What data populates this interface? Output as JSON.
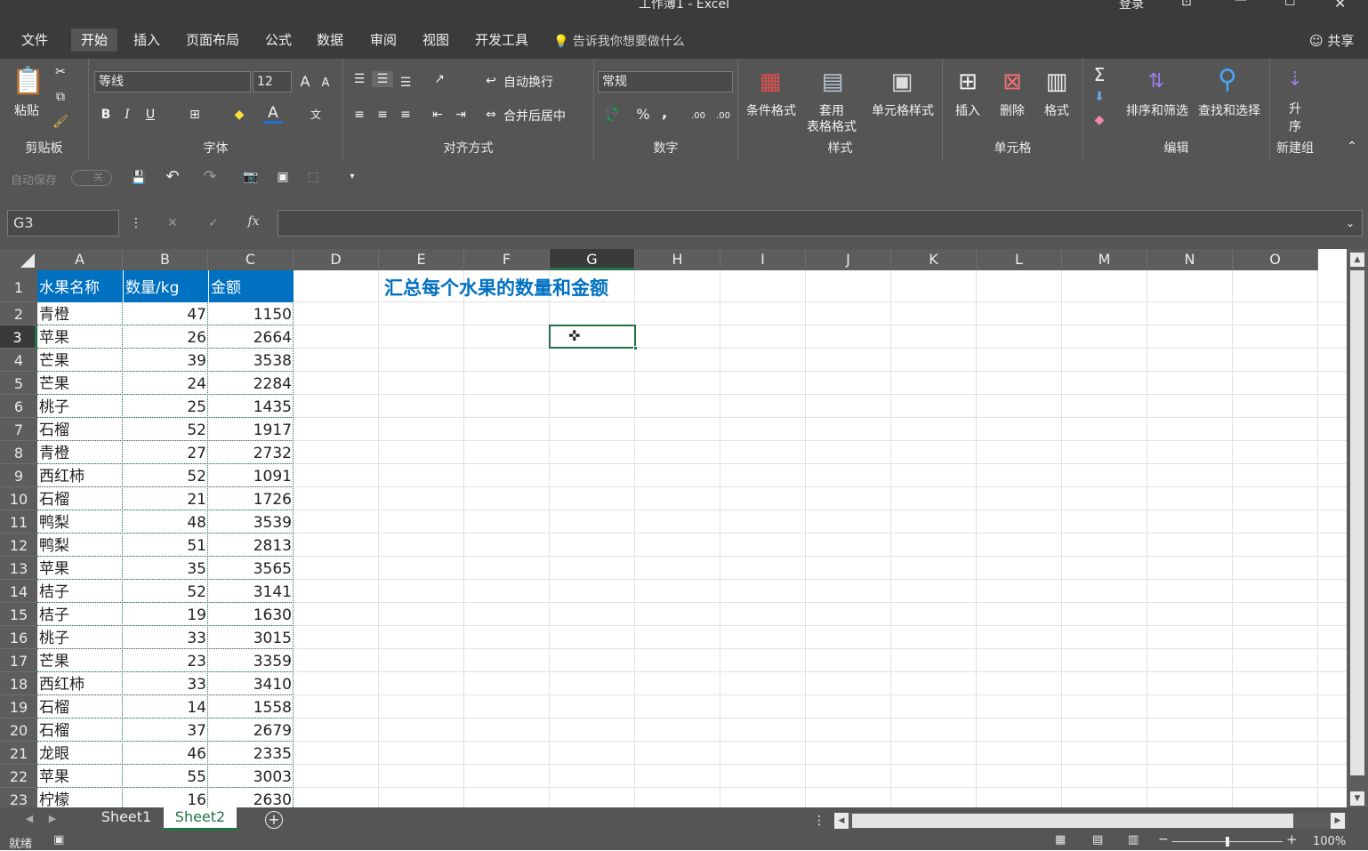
{
  "window": {
    "title": "工作簿1  -  Excel",
    "login": "登录"
  },
  "menu": {
    "tabs": [
      "文件",
      "开始",
      "插入",
      "页面布局",
      "公式",
      "数据",
      "审阅",
      "视图",
      "开发工具"
    ],
    "active": "开始",
    "tell_me": "告诉我你想要做什么",
    "share": "共享"
  },
  "ribbon": {
    "clipboard": {
      "paste": "粘贴",
      "label": "剪贴板"
    },
    "font": {
      "name": "等线",
      "size": "12",
      "bold": "B",
      "italic": "I",
      "underline": "U",
      "grow": "A",
      "shrink": "A",
      "phonetic": "文",
      "label": "字体"
    },
    "alignment": {
      "wrap": "自动换行",
      "merge": "合并后居中",
      "label": "对齐方式"
    },
    "number": {
      "format": "常规",
      "percent": "%",
      "comma": ",",
      "inc_dec": ".00",
      "label": "数字"
    },
    "styles": {
      "conditional": "条件格式",
      "table_l1": "套用",
      "table_l2": "表格格式",
      "cell_styles": "单元格样式",
      "label": "样式"
    },
    "cells": {
      "insert": "插入",
      "delete": "删除",
      "format": "格式",
      "label": "单元格"
    },
    "editing": {
      "sigma": "Σ",
      "sort": "排序和筛选",
      "find": "查找和选择",
      "label": "编辑"
    },
    "newgroup": {
      "asc_l1": "升",
      "asc_l2": "序",
      "label": "新建组"
    }
  },
  "qat": {
    "autosave": "自动保存",
    "toggle": "关"
  },
  "formula": {
    "namebox": "G3",
    "fx": "fx",
    "cancel": "✕",
    "confirm": "✓",
    "value": ""
  },
  "columns": [
    "A",
    "B",
    "C",
    "D",
    "E",
    "F",
    "G",
    "H",
    "I",
    "J",
    "K",
    "L",
    "M",
    "N",
    "O"
  ],
  "selected_col": "G",
  "selected_row": "3",
  "headers": [
    "水果名称",
    "数量/kg",
    "金额"
  ],
  "rows": [
    {
      "r": "2",
      "fruit": "青橙",
      "qty": "47",
      "amt": "1150"
    },
    {
      "r": "3",
      "fruit": "苹果",
      "qty": "26",
      "amt": "2664"
    },
    {
      "r": "4",
      "fruit": "芒果",
      "qty": "39",
      "amt": "3538"
    },
    {
      "r": "5",
      "fruit": "芒果",
      "qty": "24",
      "amt": "2284"
    },
    {
      "r": "6",
      "fruit": "桃子",
      "qty": "25",
      "amt": "1435"
    },
    {
      "r": "7",
      "fruit": "石榴",
      "qty": "52",
      "amt": "1917"
    },
    {
      "r": "8",
      "fruit": "青橙",
      "qty": "27",
      "amt": "2732"
    },
    {
      "r": "9",
      "fruit": "西红柿",
      "qty": "52",
      "amt": "1091"
    },
    {
      "r": "10",
      "fruit": "石榴",
      "qty": "21",
      "amt": "1726"
    },
    {
      "r": "11",
      "fruit": "鸭梨",
      "qty": "48",
      "amt": "3539"
    },
    {
      "r": "12",
      "fruit": "鸭梨",
      "qty": "51",
      "amt": "2813"
    },
    {
      "r": "13",
      "fruit": "苹果",
      "qty": "35",
      "amt": "3565"
    },
    {
      "r": "14",
      "fruit": "桔子",
      "qty": "52",
      "amt": "3141"
    },
    {
      "r": "15",
      "fruit": "桔子",
      "qty": "19",
      "amt": "1630"
    },
    {
      "r": "16",
      "fruit": "桃子",
      "qty": "33",
      "amt": "3015"
    },
    {
      "r": "17",
      "fruit": "芒果",
      "qty": "23",
      "amt": "3359"
    },
    {
      "r": "18",
      "fruit": "西红柿",
      "qty": "33",
      "amt": "3410"
    },
    {
      "r": "19",
      "fruit": "石榴",
      "qty": "14",
      "amt": "1558"
    },
    {
      "r": "20",
      "fruit": "石榴",
      "qty": "37",
      "amt": "2679"
    },
    {
      "r": "21",
      "fruit": "龙眼",
      "qty": "46",
      "amt": "2335"
    },
    {
      "r": "22",
      "fruit": "苹果",
      "qty": "55",
      "amt": "3003"
    },
    {
      "r": "23",
      "fruit": "柠檬",
      "qty": "16",
      "amt": "2630"
    }
  ],
  "row1": "1",
  "note": "汇总每个水果的数量和金额",
  "sheets": [
    "Sheet1",
    "Sheet2"
  ],
  "active_sheet": "Sheet2",
  "status": {
    "ready": "就绪",
    "zoom": "100%"
  },
  "colors": {
    "header_fill": "#0070c0",
    "note_text": "#0070c0",
    "selection": "#217346"
  }
}
